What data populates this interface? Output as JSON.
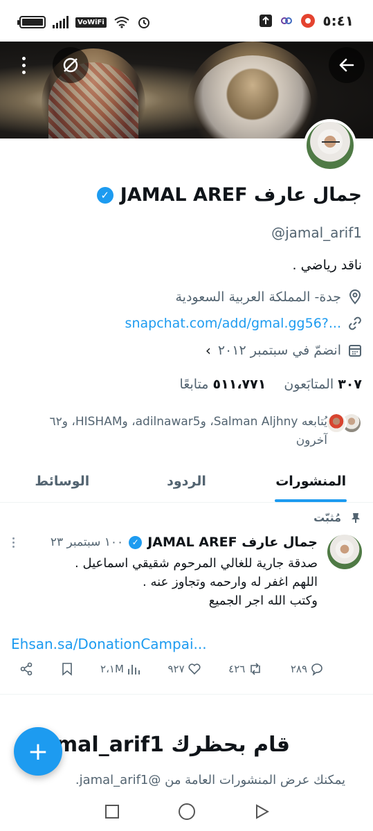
{
  "status_bar": {
    "time": "٥:٤١",
    "network_label": "VoWiFi",
    "battery_level": 0.85
  },
  "profile": {
    "name": "جمال عارف JAMAL AREF",
    "handle": "@jamal_arif1",
    "bio": "ناقد رياضي .",
    "location": "جدة- المملكة العربية السعودية",
    "link": "snapchat.com/add/gmal.gg56?...",
    "joined": "انضمّ في سبتمبر ٢٠١٢",
    "following_count": "٣٠٧",
    "following_label": "المتابَعون",
    "followers_count": "٥١١،٧٧١",
    "followers_label": "متابعًا",
    "followed_by": "يُتابعه Salman Aljhny، وadilnawar5، وHISHAM، و٦٢ آخرون"
  },
  "tabs": [
    {
      "label": "المنشورات",
      "active": true
    },
    {
      "label": "الردود",
      "active": false
    },
    {
      "label": "الوسائط",
      "active": false
    }
  ],
  "pinned_post": {
    "pinned_label": "مُثبّت",
    "author_name": "جمال عارف JAMAL AREF",
    "date": "١٠٠ سبتمبر ٢٣",
    "body_line1": "صدقة جارية للغالي المرحوم شقيقي اسماعيل .",
    "body_line2": "اللهم اغفر له وارحمه وتجاوز عنه .",
    "body_line3": "وكتب الله اجر الجميع",
    "link": "Ehsan.sa/DonationCampai...",
    "replies": "٢٨٩",
    "reposts": "٤٢٦",
    "likes": "٩٢٧",
    "views": "٢،١M"
  },
  "blocked": {
    "title": "قام بحظرك jamal_arif1",
    "subtitle": "يمكنك عرض المنشورات العامة من @jamal_arif1."
  },
  "icons": {
    "back": "arrow-left-icon",
    "mute": "mute-icon",
    "more": "more-vertical-icon",
    "verified": "verified-badge-icon",
    "location": "location-pin-icon",
    "link": "link-icon",
    "calendar": "calendar-icon",
    "compose": "plus-icon"
  },
  "colors": {
    "accent": "#1d9bf0",
    "text_primary": "#0f1419",
    "text_secondary": "#536471"
  }
}
